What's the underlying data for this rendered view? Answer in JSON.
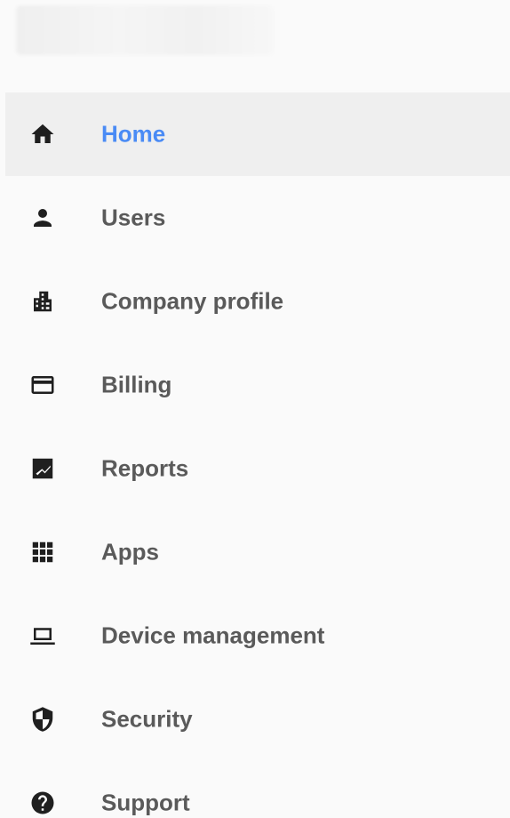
{
  "colors": {
    "accent": "#4a8bf5",
    "label": "#5a5a5a",
    "icon": "#1f1f1f",
    "active_background": "#efefef"
  },
  "sidebar": {
    "items": [
      {
        "label": "Home",
        "icon": "home-icon",
        "active": true
      },
      {
        "label": "Users",
        "icon": "person-icon",
        "active": false
      },
      {
        "label": "Company profile",
        "icon": "building-icon",
        "active": false
      },
      {
        "label": "Billing",
        "icon": "credit-card-icon",
        "active": false
      },
      {
        "label": "Reports",
        "icon": "chart-icon",
        "active": false
      },
      {
        "label": "Apps",
        "icon": "grid-icon",
        "active": false
      },
      {
        "label": "Device management",
        "icon": "laptop-icon",
        "active": false
      },
      {
        "label": "Security",
        "icon": "shield-icon",
        "active": false
      },
      {
        "label": "Support",
        "icon": "help-icon",
        "active": false
      }
    ]
  }
}
